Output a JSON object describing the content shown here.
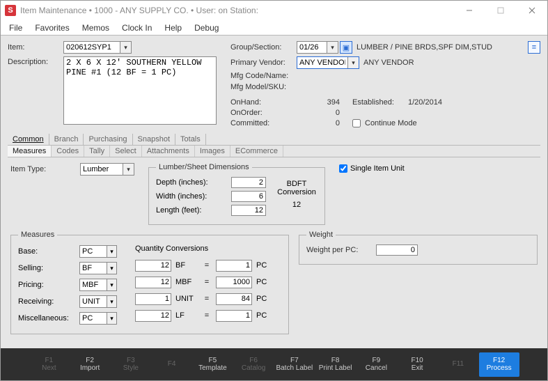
{
  "window": {
    "title": "Item Maintenance   •   1000 - ANY SUPPLY CO.   •   User:             on Station:"
  },
  "menu": {
    "file": "File",
    "favorites": "Favorites",
    "memos": "Memos",
    "clockin": "Clock In",
    "help": "Help",
    "debug": "Debug"
  },
  "header": {
    "item_label": "Item:",
    "item_value": "020612SYP1",
    "description_label": "Description:",
    "description_value": "2 X 6 X 12' SOUTHERN YELLOW PINE #1 (12 BF = 1 PC)",
    "group_label": "Group/Section:",
    "group_value": "01/26",
    "group_name": "LUMBER / PINE BRDS,SPF DIM,STUD",
    "vendor_label": "Primary Vendor:",
    "vendor_value": "ANY VENDOR",
    "vendor_name": "ANY VENDOR",
    "mfg_code_label": "Mfg Code/Name:",
    "mfg_sku_label": "Mfg Model/SKU:",
    "onhand_label": "OnHand:",
    "onhand_value": "394",
    "onorder_label": "OnOrder:",
    "onorder_value": "0",
    "committed_label": "Committed:",
    "committed_value": "0",
    "established_label": "Established:",
    "established_value": "1/20/2014",
    "continue_mode_label": "Continue Mode"
  },
  "tabs": {
    "common": "Common",
    "branch": "Branch",
    "purchasing": "Purchasing",
    "snapshot": "Snapshot",
    "totals": "Totals"
  },
  "subtabs": {
    "measures": "Measures",
    "codes": "Codes",
    "tally": "Tally",
    "select": "Select",
    "attachments": "Attachments",
    "images": "Images",
    "ecommerce": "ECommerce"
  },
  "measures_panel": {
    "item_type_label": "Item Type:",
    "item_type_value": "Lumber",
    "dims_legend": "Lumber/Sheet Dimensions",
    "depth_label": "Depth (inches):",
    "depth_value": "2",
    "width_label": "Width   (inches):",
    "width_value": "6",
    "length_label": "Length (feet):",
    "length_value": "12",
    "bdft_label": "BDFT Conversion",
    "bdft_value": "12",
    "single_item_label": "Single Item Unit",
    "measures_legend": "Measures",
    "base_label": "Base:",
    "base_value": "PC",
    "selling_label": "Selling:",
    "selling_value": "BF",
    "pricing_label": "Pricing:",
    "pricing_value": "MBF",
    "receiving_label": "Receiving:",
    "receiving_value": "UNIT",
    "misc_label": "Miscellaneous:",
    "misc_value": "PC",
    "qty_conv_label": "Quantity Conversions",
    "conv": {
      "r1_a": "12",
      "r1_u1": "BF",
      "r1_b": "1",
      "r1_u2": "PC",
      "r2_a": "12",
      "r2_u1": "MBF",
      "r2_b": "1000",
      "r2_u2": "PC",
      "r3_a": "1",
      "r3_u1": "UNIT",
      "r3_b": "84",
      "r3_u2": "PC",
      "r4_a": "12",
      "r4_u1": "LF",
      "r4_b": "1",
      "r4_u2": "PC"
    },
    "weight_legend": "Weight",
    "weight_label": "Weight per PC:",
    "weight_value": "0"
  },
  "footer": {
    "f1": {
      "k": "F1",
      "t": "Next"
    },
    "f2": {
      "k": "F2",
      "t": "Import"
    },
    "f3": {
      "k": "F3",
      "t": "Style"
    },
    "f4": {
      "k": "F4",
      "t": ""
    },
    "f5": {
      "k": "F5",
      "t": "Template"
    },
    "f6": {
      "k": "F6",
      "t": "Catalog"
    },
    "f7": {
      "k": "F7",
      "t": "Batch Label"
    },
    "f8": {
      "k": "F8",
      "t": "Print Label"
    },
    "f9": {
      "k": "F9",
      "t": "Cancel"
    },
    "f10": {
      "k": "F10",
      "t": "Exit"
    },
    "f11": {
      "k": "F11",
      "t": ""
    },
    "f12": {
      "k": "F12",
      "t": "Process"
    }
  }
}
